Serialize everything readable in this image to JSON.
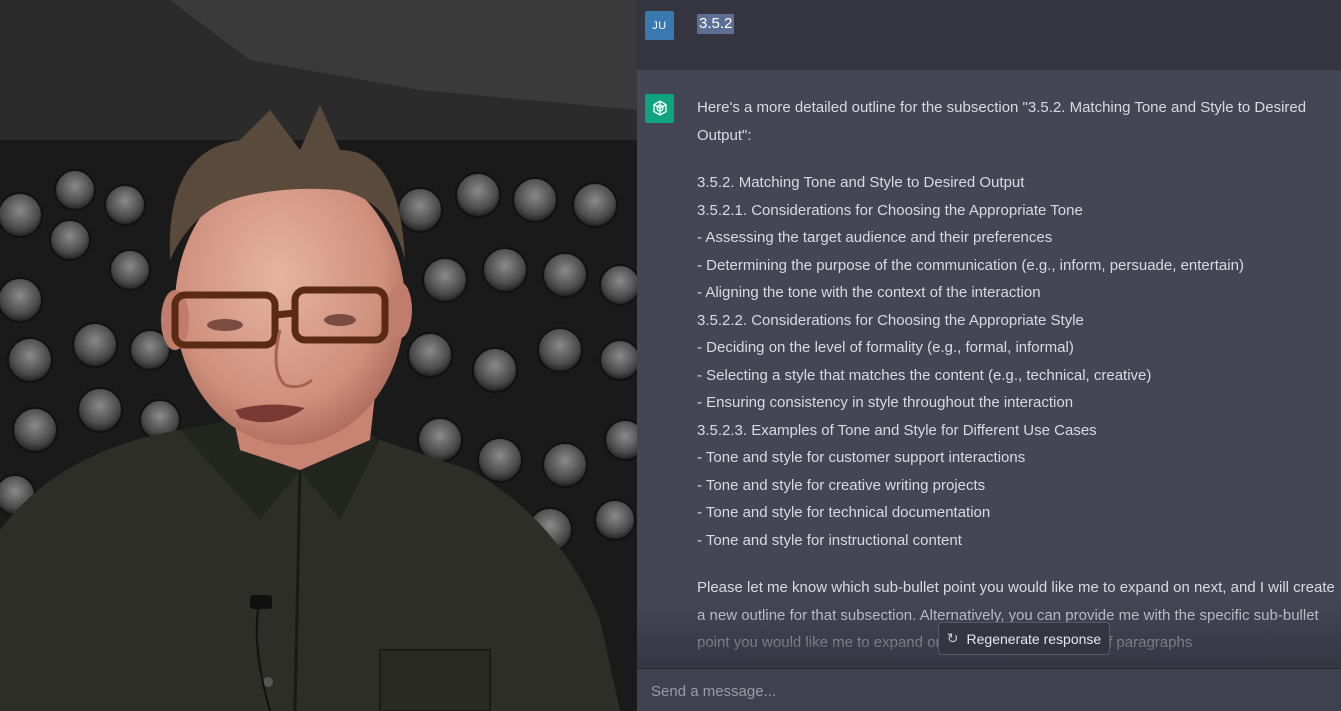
{
  "user_message": {
    "avatar": "JU",
    "text": "3.5.2"
  },
  "assistant_message": {
    "avatar_icon": "openai-logo-icon",
    "intro": "Here's a more detailed outline for the subsection \"3.5.2. Matching Tone and Style to Desired Output\":",
    "lines": [
      "3.5.2. Matching Tone and Style to Desired Output",
      "3.5.2.1. Considerations for Choosing the Appropriate Tone",
      "- Assessing the target audience and their preferences",
      "- Determining the purpose of the communication (e.g., inform, persuade, entertain)",
      "- Aligning the tone with the context of the interaction",
      "3.5.2.2. Considerations for Choosing the Appropriate Style",
      "- Deciding on the level of formality (e.g., formal, informal)",
      "- Selecting a style that matches the content (e.g., technical, creative)",
      "- Ensuring consistency in style throughout the interaction",
      "3.5.2.3. Examples of Tone and Style for Different Use Cases",
      "- Tone and style for customer support interactions",
      "- Tone and style for creative writing projects",
      "- Tone and style for technical documentation",
      "- Tone and style for instructional content"
    ],
    "closing": "Please let me know which sub-bullet point you would like me to expand on next, and I will create a new outline for that subsection. Alternatively, you can provide me with the specific sub-bullet point you would like me to expand on along with the number of paragraphs"
  },
  "regenerate_button": {
    "label": "Regenerate response",
    "icon": "refresh-icon"
  },
  "message_input": {
    "placeholder": "Send a message..."
  },
  "colors": {
    "user_row_bg": "#343541",
    "assistant_row_bg": "#444654",
    "user_avatar": "#3a78b0",
    "gpt_avatar": "#10a37f"
  }
}
